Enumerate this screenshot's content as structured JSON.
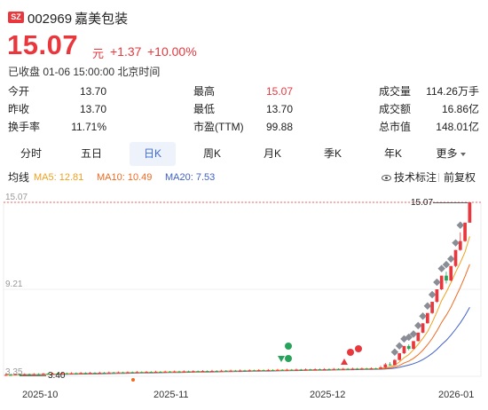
{
  "stock": {
    "exchange": "SZ",
    "code": "002969",
    "name": "嘉美包装",
    "price": "15.07",
    "unit": "元",
    "change": "+1.37",
    "change_pct": "+10.00%",
    "status": "已收盘 01-06 15:00:00 北京时间"
  },
  "stats": [
    {
      "label": "今开",
      "value": "13.70",
      "color": "normal"
    },
    {
      "label": "最高",
      "value": "15.07",
      "color": "up"
    },
    {
      "label": "成交量",
      "value": "114.26万手",
      "color": "normal"
    },
    {
      "label": "昨收",
      "value": "13.70",
      "color": "normal"
    },
    {
      "label": "最低",
      "value": "13.70",
      "color": "normal"
    },
    {
      "label": "成交额",
      "value": "16.86亿",
      "color": "normal"
    },
    {
      "label": "换手率",
      "value": "11.71%",
      "color": "normal"
    },
    {
      "label": "市盈(TTM)",
      "value": "99.88",
      "color": "normal"
    },
    {
      "label": "总市值",
      "value": "148.01亿",
      "color": "normal"
    }
  ],
  "tabs": [
    {
      "label": "分时",
      "active": false
    },
    {
      "label": "五日",
      "active": false
    },
    {
      "label": "日K",
      "active": true
    },
    {
      "label": "周K",
      "active": false
    },
    {
      "label": "月K",
      "active": false
    },
    {
      "label": "季K",
      "active": false
    },
    {
      "label": "年K",
      "active": false
    },
    {
      "label": "更多",
      "active": false
    }
  ],
  "ma_bar": {
    "label": "均线",
    "ma5": "MA5: 12.81",
    "ma10": "MA10: 10.49",
    "ma20": "MA20: 7.53",
    "tech_label": "技术标注",
    "adjust_label": "前复权"
  },
  "colors": {
    "up": "#e8383d",
    "down": "#27a35a",
    "ma5": "#f0a01e",
    "ma10": "#ee6a22",
    "ma20": "#4060c8",
    "marker": "#8a8d96",
    "accent": "#3a6bd8"
  },
  "chart_data": {
    "type": "candlestick",
    "y_ticks": [
      "15.07",
      "9.21",
      "3.35"
    ],
    "ylim": [
      3.35,
      15.07
    ],
    "x_labels": [
      "2025-10",
      "2025-11",
      "2025-12",
      "2026-01"
    ],
    "high_callout": "15.07",
    "low_callout": "3.40",
    "grid": true,
    "candles": [
      {
        "o": 3.4,
        "c": 3.45,
        "h": 3.52,
        "l": 3.38
      },
      {
        "o": 3.45,
        "c": 3.42,
        "h": 3.5,
        "l": 3.4
      },
      {
        "o": 3.42,
        "c": 3.47,
        "h": 3.51,
        "l": 3.41
      },
      {
        "o": 3.47,
        "c": 3.44,
        "h": 3.52,
        "l": 3.42
      },
      {
        "o": 3.44,
        "c": 3.49,
        "h": 3.55,
        "l": 3.43
      },
      {
        "o": 3.49,
        "c": 3.46,
        "h": 3.54,
        "l": 3.44
      },
      {
        "o": 3.46,
        "c": 3.5,
        "h": 3.56,
        "l": 3.45
      },
      {
        "o": 3.5,
        "c": 3.47,
        "h": 3.55,
        "l": 3.45
      },
      {
        "o": 3.47,
        "c": 3.52,
        "h": 3.58,
        "l": 3.46
      },
      {
        "o": 3.52,
        "c": 3.49,
        "h": 3.57,
        "l": 3.47
      },
      {
        "o": 3.49,
        "c": 3.53,
        "h": 3.6,
        "l": 3.48
      },
      {
        "o": 3.53,
        "c": 3.5,
        "h": 3.58,
        "l": 3.48
      },
      {
        "o": 3.5,
        "c": 3.55,
        "h": 3.62,
        "l": 3.49
      },
      {
        "o": 3.55,
        "c": 3.52,
        "h": 3.6,
        "l": 3.5
      },
      {
        "o": 3.52,
        "c": 3.56,
        "h": 3.63,
        "l": 3.51
      },
      {
        "o": 3.56,
        "c": 3.53,
        "h": 3.61,
        "l": 3.51
      },
      {
        "o": 3.53,
        "c": 3.57,
        "h": 3.64,
        "l": 3.52
      },
      {
        "o": 3.57,
        "c": 3.54,
        "h": 3.62,
        "l": 3.52
      },
      {
        "o": 3.54,
        "c": 3.58,
        "h": 3.65,
        "l": 3.53
      },
      {
        "o": 3.58,
        "c": 3.55,
        "h": 3.63,
        "l": 3.53
      },
      {
        "o": 3.55,
        "c": 3.59,
        "h": 3.66,
        "l": 3.54
      },
      {
        "o": 3.59,
        "c": 3.56,
        "h": 3.64,
        "l": 3.54
      },
      {
        "o": 3.56,
        "c": 3.6,
        "h": 3.67,
        "l": 3.55
      },
      {
        "o": 3.6,
        "c": 3.57,
        "h": 3.65,
        "l": 3.55
      },
      {
        "o": 3.57,
        "c": 3.61,
        "h": 3.68,
        "l": 3.56
      },
      {
        "o": 3.61,
        "c": 3.58,
        "h": 3.66,
        "l": 3.56
      },
      {
        "o": 3.58,
        "c": 3.62,
        "h": 3.69,
        "l": 3.57
      },
      {
        "o": 3.62,
        "c": 3.59,
        "h": 3.67,
        "l": 3.57
      },
      {
        "o": 3.59,
        "c": 3.63,
        "h": 3.7,
        "l": 3.58
      },
      {
        "o": 3.63,
        "c": 3.6,
        "h": 3.68,
        "l": 3.58
      },
      {
        "o": 3.6,
        "c": 3.64,
        "h": 3.71,
        "l": 3.59
      },
      {
        "o": 3.64,
        "c": 3.61,
        "h": 3.69,
        "l": 3.59
      },
      {
        "o": 3.61,
        "c": 3.65,
        "h": 3.72,
        "l": 3.6
      },
      {
        "o": 3.65,
        "c": 3.62,
        "h": 3.7,
        "l": 3.6
      },
      {
        "o": 3.62,
        "c": 3.66,
        "h": 3.73,
        "l": 3.61
      },
      {
        "o": 3.66,
        "c": 3.63,
        "h": 3.71,
        "l": 3.61
      },
      {
        "o": 3.63,
        "c": 3.67,
        "h": 3.74,
        "l": 3.62
      },
      {
        "o": 3.67,
        "c": 3.64,
        "h": 3.72,
        "l": 3.62
      },
      {
        "o": 3.64,
        "c": 3.68,
        "h": 3.75,
        "l": 3.63
      },
      {
        "o": 3.68,
        "c": 3.65,
        "h": 3.73,
        "l": 3.63
      },
      {
        "o": 3.65,
        "c": 3.69,
        "h": 3.76,
        "l": 3.64
      },
      {
        "o": 3.69,
        "c": 3.66,
        "h": 3.74,
        "l": 3.64
      },
      {
        "o": 3.66,
        "c": 3.7,
        "h": 3.77,
        "l": 3.65
      },
      {
        "o": 3.7,
        "c": 3.67,
        "h": 3.75,
        "l": 3.65
      },
      {
        "o": 3.67,
        "c": 3.71,
        "h": 3.78,
        "l": 3.66
      },
      {
        "o": 3.71,
        "c": 3.68,
        "h": 3.76,
        "l": 3.66
      },
      {
        "o": 3.68,
        "c": 3.72,
        "h": 3.79,
        "l": 3.67
      },
      {
        "o": 3.72,
        "c": 3.69,
        "h": 3.77,
        "l": 3.67
      },
      {
        "o": 3.69,
        "c": 3.73,
        "h": 3.8,
        "l": 3.68
      },
      {
        "o": 3.73,
        "c": 3.7,
        "h": 3.78,
        "l": 3.68
      },
      {
        "o": 3.7,
        "c": 3.74,
        "h": 3.81,
        "l": 3.69
      },
      {
        "o": 3.74,
        "c": 3.71,
        "h": 3.79,
        "l": 3.69
      },
      {
        "o": 3.71,
        "c": 3.75,
        "h": 3.82,
        "l": 3.7
      },
      {
        "o": 3.75,
        "c": 3.72,
        "h": 3.8,
        "l": 3.7
      },
      {
        "o": 3.72,
        "c": 3.76,
        "h": 3.83,
        "l": 3.71
      },
      {
        "o": 3.76,
        "c": 3.73,
        "h": 3.81,
        "l": 3.71
      },
      {
        "o": 3.73,
        "c": 3.77,
        "h": 3.84,
        "l": 3.72
      },
      {
        "o": 3.77,
        "c": 3.74,
        "h": 3.82,
        "l": 3.72
      },
      {
        "o": 3.74,
        "c": 3.78,
        "h": 3.85,
        "l": 3.73
      },
      {
        "o": 3.78,
        "c": 3.75,
        "h": 3.83,
        "l": 3.73
      },
      {
        "o": 3.75,
        "c": 3.79,
        "h": 3.86,
        "l": 3.74
      },
      {
        "o": 3.79,
        "c": 3.76,
        "h": 3.84,
        "l": 3.74
      },
      {
        "o": 3.76,
        "c": 3.8,
        "h": 3.87,
        "l": 3.75
      },
      {
        "o": 3.8,
        "c": 3.77,
        "h": 3.85,
        "l": 3.75
      },
      {
        "o": 3.77,
        "c": 3.81,
        "h": 3.88,
        "l": 3.76
      },
      {
        "o": 3.81,
        "c": 3.78,
        "h": 3.86,
        "l": 3.76
      },
      {
        "o": 3.78,
        "c": 3.82,
        "h": 3.89,
        "l": 3.77
      },
      {
        "o": 3.82,
        "c": 3.79,
        "h": 3.87,
        "l": 3.77
      },
      {
        "o": 3.79,
        "c": 3.83,
        "h": 3.9,
        "l": 3.78
      },
      {
        "o": 3.83,
        "c": 3.8,
        "h": 3.88,
        "l": 3.78
      },
      {
        "o": 3.8,
        "c": 3.84,
        "h": 3.91,
        "l": 3.79
      },
      {
        "o": 3.84,
        "c": 3.81,
        "h": 3.89,
        "l": 3.79
      },
      {
        "o": 3.81,
        "c": 3.85,
        "h": 3.92,
        "l": 3.8
      },
      {
        "o": 3.85,
        "c": 3.82,
        "h": 3.9,
        "l": 3.8
      },
      {
        "o": 3.82,
        "c": 3.86,
        "h": 3.93,
        "l": 3.81
      },
      {
        "o": 3.86,
        "c": 3.83,
        "h": 3.91,
        "l": 3.81
      },
      {
        "o": 3.83,
        "c": 3.87,
        "h": 3.94,
        "l": 3.82
      },
      {
        "o": 3.87,
        "c": 3.84,
        "h": 3.92,
        "l": 3.82
      },
      {
        "o": 3.84,
        "c": 3.88,
        "h": 3.95,
        "l": 3.83
      },
      {
        "o": 3.88,
        "c": 3.85,
        "h": 3.93,
        "l": 3.83
      },
      {
        "o": 3.85,
        "c": 3.95,
        "h": 4.05,
        "l": 3.84
      },
      {
        "o": 3.95,
        "c": 4.15,
        "h": 4.25,
        "l": 3.9
      },
      {
        "o": 4.15,
        "c": 4.1,
        "h": 4.3,
        "l": 4.05
      },
      {
        "o": 4.1,
        "c": 4.45,
        "h": 4.5,
        "l": 4.08
      },
      {
        "o": 4.45,
        "c": 4.9,
        "h": 4.92,
        "l": 4.4
      },
      {
        "o": 4.9,
        "c": 5.39,
        "h": 5.39,
        "l": 4.85
      },
      {
        "o": 5.39,
        "c": 5.2,
        "h": 5.5,
        "l": 5.1
      },
      {
        "o": 5.2,
        "c": 5.72,
        "h": 5.72,
        "l": 5.15
      },
      {
        "o": 5.72,
        "c": 6.29,
        "h": 6.29,
        "l": 5.7
      },
      {
        "o": 6.29,
        "c": 6.92,
        "h": 6.92,
        "l": 6.25
      },
      {
        "o": 6.92,
        "c": 7.61,
        "h": 7.61,
        "l": 6.9
      },
      {
        "o": 7.61,
        "c": 8.37,
        "h": 8.37,
        "l": 7.55
      },
      {
        "o": 8.37,
        "c": 9.21,
        "h": 9.21,
        "l": 8.3
      },
      {
        "o": 9.21,
        "c": 10.13,
        "h": 10.13,
        "l": 9.15
      },
      {
        "o": 10.13,
        "c": 9.8,
        "h": 10.4,
        "l": 9.6
      },
      {
        "o": 9.8,
        "c": 10.78,
        "h": 10.78,
        "l": 9.75
      },
      {
        "o": 10.78,
        "c": 11.86,
        "h": 11.86,
        "l": 10.7
      },
      {
        "o": 11.86,
        "c": 12.46,
        "h": 13.05,
        "l": 11.8
      },
      {
        "o": 12.46,
        "c": 13.7,
        "h": 13.7,
        "l": 12.4
      },
      {
        "o": 13.7,
        "c": 15.07,
        "h": 15.07,
        "l": 13.7
      }
    ]
  }
}
